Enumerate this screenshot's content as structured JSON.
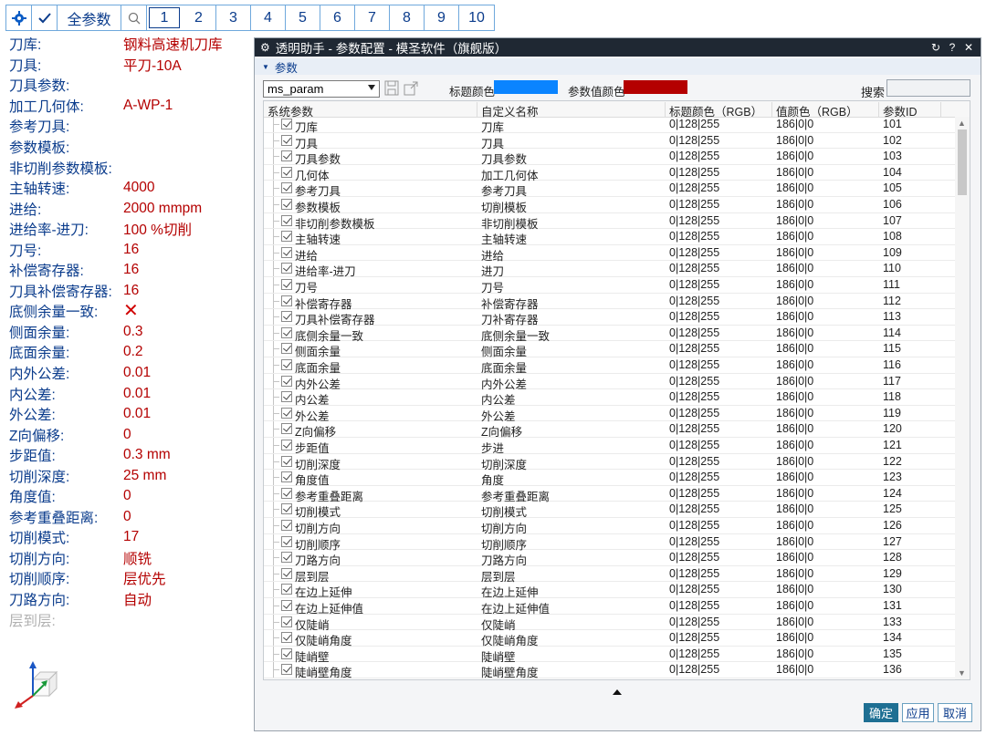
{
  "toolbar": {
    "gear_icon": "gear-icon",
    "check_icon": "check-icon",
    "all_params": "全参数",
    "search_icon": "search-icon",
    "pages": [
      "1",
      "2",
      "3",
      "4",
      "5",
      "6",
      "7",
      "8",
      "9",
      "10"
    ],
    "active_page": "1"
  },
  "left_params": [
    {
      "label": "刀库:",
      "value": "钢料高速机刀库"
    },
    {
      "label": "刀具:",
      "value": "平刀-10A"
    },
    {
      "label": "刀具参数:",
      "value": ""
    },
    {
      "label": "加工几何体:",
      "value": "A-WP-1"
    },
    {
      "label": "参考刀具:",
      "value": ""
    },
    {
      "label": "参数模板:",
      "value": ""
    },
    {
      "label": "非切削参数模板:",
      "value": ""
    },
    {
      "label": "主轴转速:",
      "value": "4000"
    },
    {
      "label": "进给:",
      "value": "2000  mmpm"
    },
    {
      "label": "进给率-进刀:",
      "value": "100  %切削"
    },
    {
      "label": "刀号:",
      "value": "16"
    },
    {
      "label": "补偿寄存器:",
      "value": "16"
    },
    {
      "label": "刀具补偿寄存器:",
      "value": "16"
    },
    {
      "label": "底侧余量一致:",
      "value": "✕"
    },
    {
      "label": "侧面余量:",
      "value": "0.3"
    },
    {
      "label": "底面余量:",
      "value": "0.2"
    },
    {
      "label": "内外公差:",
      "value": "0.01"
    },
    {
      "label": "内公差:",
      "value": "0.01"
    },
    {
      "label": "外公差:",
      "value": "0.01"
    },
    {
      "label": "Z向偏移:",
      "value": "0"
    },
    {
      "label": "步距值:",
      "value": "0.3  mm"
    },
    {
      "label": "切削深度:",
      "value": "25  mm"
    },
    {
      "label": "角度值:",
      "value": "0"
    },
    {
      "label": "参考重叠距离:",
      "value": "0"
    },
    {
      "label": "切削模式:",
      "value": "17"
    },
    {
      "label": "切削方向:",
      "value": "顺铣"
    },
    {
      "label": "切削顺序:",
      "value": "层优先"
    },
    {
      "label": "刀路方向:",
      "value": "自动"
    },
    {
      "label": "层到层:",
      "value": ""
    }
  ],
  "dialog": {
    "title": "透明助手 - 参数配置 - 模圣软件（旗舰版）",
    "title_icon": "gear-icon",
    "controls": [
      "↻",
      "?",
      "✕"
    ],
    "group_label": "参数",
    "combo_value": "ms_param",
    "title_color_label": "标题颜色",
    "title_color": "#0a84ff",
    "value_color_label": "参数值颜色",
    "value_color": "#b40000",
    "search_label": "搜索",
    "search_value": "",
    "columns": [
      "系统参数",
      "自定义名称",
      "标题颜色（RGB）",
      "值颜色（RGB）",
      "参数ID"
    ],
    "rows": [
      [
        "刀库",
        "刀库",
        "0|128|255",
        "186|0|0",
        "101"
      ],
      [
        "刀具",
        "刀具",
        "0|128|255",
        "186|0|0",
        "102"
      ],
      [
        "刀具参数",
        "刀具参数",
        "0|128|255",
        "186|0|0",
        "103"
      ],
      [
        "几何体",
        "加工几何体",
        "0|128|255",
        "186|0|0",
        "104"
      ],
      [
        "参考刀具",
        "参考刀具",
        "0|128|255",
        "186|0|0",
        "105"
      ],
      [
        "参数模板",
        "切削模板",
        "0|128|255",
        "186|0|0",
        "106"
      ],
      [
        "非切削参数模板",
        "非切削模板",
        "0|128|255",
        "186|0|0",
        "107"
      ],
      [
        "主轴转速",
        "主轴转速",
        "0|128|255",
        "186|0|0",
        "108"
      ],
      [
        "进给",
        "进给",
        "0|128|255",
        "186|0|0",
        "109"
      ],
      [
        "进给率-进刀",
        "进刀",
        "0|128|255",
        "186|0|0",
        "110"
      ],
      [
        "刀号",
        "刀号",
        "0|128|255",
        "186|0|0",
        "111"
      ],
      [
        "补偿寄存器",
        "补偿寄存器",
        "0|128|255",
        "186|0|0",
        "112"
      ],
      [
        "刀具补偿寄存器",
        "刀补寄存器",
        "0|128|255",
        "186|0|0",
        "113"
      ],
      [
        "底侧余量一致",
        "底侧余量一致",
        "0|128|255",
        "186|0|0",
        "114"
      ],
      [
        "侧面余量",
        "侧面余量",
        "0|128|255",
        "186|0|0",
        "115"
      ],
      [
        "底面余量",
        "底面余量",
        "0|128|255",
        "186|0|0",
        "116"
      ],
      [
        "内外公差",
        "内外公差",
        "0|128|255",
        "186|0|0",
        "117"
      ],
      [
        "内公差",
        "内公差",
        "0|128|255",
        "186|0|0",
        "118"
      ],
      [
        "外公差",
        "外公差",
        "0|128|255",
        "186|0|0",
        "119"
      ],
      [
        "Z向偏移",
        "Z向偏移",
        "0|128|255",
        "186|0|0",
        "120"
      ],
      [
        "步距值",
        "步进",
        "0|128|255",
        "186|0|0",
        "121"
      ],
      [
        "切削深度",
        "切削深度",
        "0|128|255",
        "186|0|0",
        "122"
      ],
      [
        "角度值",
        "角度",
        "0|128|255",
        "186|0|0",
        "123"
      ],
      [
        "参考重叠距离",
        "参考重叠距离",
        "0|128|255",
        "186|0|0",
        "124"
      ],
      [
        "切削模式",
        "切削模式",
        "0|128|255",
        "186|0|0",
        "125"
      ],
      [
        "切削方向",
        "切削方向",
        "0|128|255",
        "186|0|0",
        "126"
      ],
      [
        "切削顺序",
        "切削顺序",
        "0|128|255",
        "186|0|0",
        "127"
      ],
      [
        "刀路方向",
        "刀路方向",
        "0|128|255",
        "186|0|0",
        "128"
      ],
      [
        "层到层",
        "层到层",
        "0|128|255",
        "186|0|0",
        "129"
      ],
      [
        "在边上延伸",
        "在边上延伸",
        "0|128|255",
        "186|0|0",
        "130"
      ],
      [
        "在边上延伸值",
        "在边上延伸值",
        "0|128|255",
        "186|0|0",
        "131"
      ],
      [
        "仅陡峭",
        "仅陡峭",
        "0|128|255",
        "186|0|0",
        "133"
      ],
      [
        "仅陡峭角度",
        "仅陡峭角度",
        "0|128|255",
        "186|0|0",
        "134"
      ],
      [
        "陡峭壁",
        "陡峭壁",
        "0|128|255",
        "186|0|0",
        "135"
      ],
      [
        "陡峭壁角度",
        "陡峭壁角度",
        "0|128|255",
        "186|0|0",
        "136"
      ]
    ],
    "buttons": {
      "ok": "确定",
      "apply": "应用",
      "cancel": "取消"
    }
  }
}
